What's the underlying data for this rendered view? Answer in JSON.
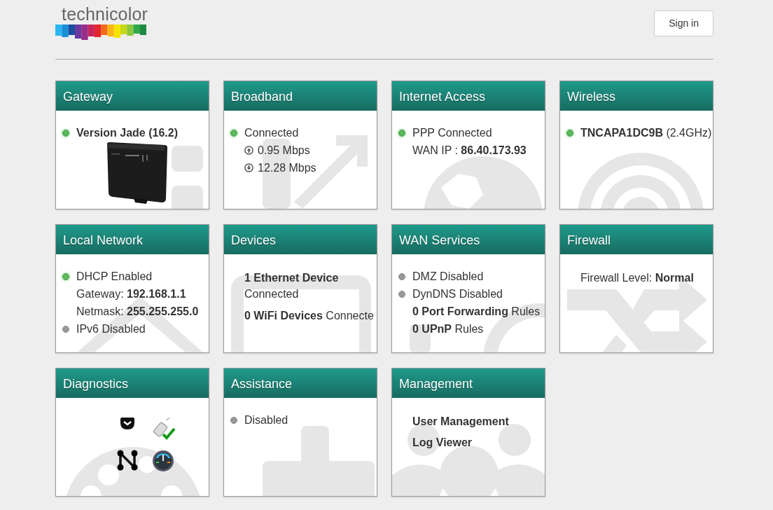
{
  "header": {
    "logo_text": "technicolor",
    "sign_in": "Sign in"
  },
  "cards": [
    {
      "title": "Gateway",
      "kind": "gateway",
      "lines": [
        {
          "kind": "status",
          "on": true,
          "bold": true,
          "text": "Version Jade (16.2)"
        }
      ]
    },
    {
      "title": "Broadband",
      "kind": "broadband",
      "lines": [
        {
          "kind": "status",
          "on": true,
          "text": "Connected"
        },
        {
          "kind": "up",
          "text": "0.95 Mbps"
        },
        {
          "kind": "down",
          "text": "12.28 Mbps"
        }
      ]
    },
    {
      "title": "Internet Access",
      "kind": "internet",
      "lines": [
        {
          "kind": "status",
          "on": true,
          "text": "PPP Connected"
        },
        {
          "kind": "text",
          "text": "WAN IP : **86.40.173.93**"
        }
      ]
    },
    {
      "title": "Wireless",
      "kind": "wireless",
      "lines": [
        {
          "kind": "status",
          "on": true,
          "text": "**TNCAPA1DC9B** (2.4GHz)"
        }
      ]
    },
    {
      "title": "Local Network",
      "kind": "local",
      "lines": [
        {
          "kind": "status",
          "on": true,
          "text": "DHCP Enabled"
        },
        {
          "kind": "text",
          "text": "Gateway: **192.168.1.1**"
        },
        {
          "kind": "text",
          "text": "Netmask: **255.255.255.0**"
        },
        {
          "kind": "status",
          "on": false,
          "text": "IPv6 Disabled"
        }
      ]
    },
    {
      "title": "Devices",
      "kind": "devices",
      "lines": [
        {
          "kind": "text",
          "text": "**1 Ethernet Device** Connected"
        },
        {
          "kind": "text",
          "text": "**0 WiFi Devices** Connecte"
        }
      ]
    },
    {
      "title": "WAN Services",
      "kind": "wan",
      "lines": [
        {
          "kind": "status",
          "on": false,
          "text": "DMZ Disabled"
        },
        {
          "kind": "status",
          "on": false,
          "text": "DynDNS Disabled"
        },
        {
          "kind": "text",
          "text": "**0 Port Forwarding** Rules"
        },
        {
          "kind": "text",
          "text": "**0 UPnP** Rules"
        }
      ]
    },
    {
      "title": "Firewall",
      "kind": "firewall",
      "lines": [
        {
          "kind": "text",
          "text": "Firewall Level: **Normal**"
        }
      ]
    },
    {
      "title": "Diagnostics",
      "kind": "diagnostics"
    },
    {
      "title": "Assistance",
      "kind": "assistance",
      "lines": [
        {
          "kind": "status",
          "on": false,
          "text": "Disabled"
        }
      ]
    },
    {
      "title": "Management",
      "kind": "management",
      "lines": [
        {
          "kind": "link",
          "bold": true,
          "text": "User Management"
        },
        {
          "kind": "link",
          "bold": true,
          "text": "Log Viewer"
        }
      ]
    }
  ]
}
